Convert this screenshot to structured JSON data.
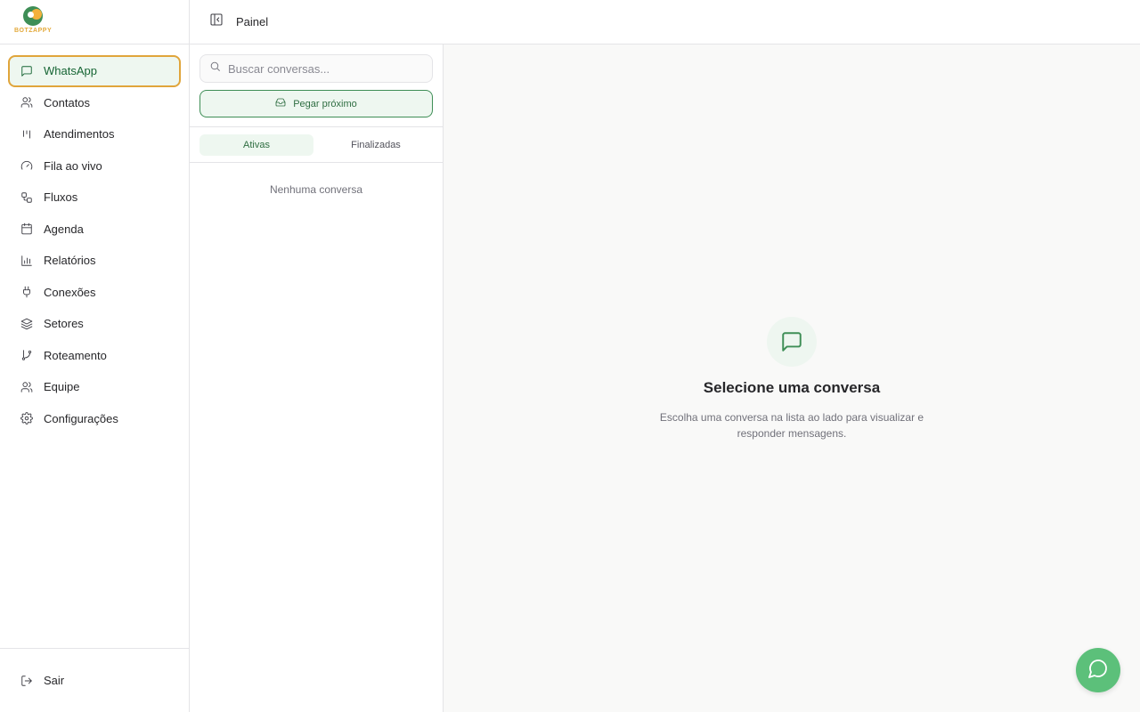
{
  "brand": {
    "wordmark": "BOTZAPPY"
  },
  "topbar": {
    "title": "Painel"
  },
  "sidebar": {
    "items": [
      {
        "label": "WhatsApp",
        "icon": "message-square-icon",
        "active": true
      },
      {
        "label": "Contatos",
        "icon": "users-icon"
      },
      {
        "label": "Atendimentos",
        "icon": "kanban-icon"
      },
      {
        "label": "Fila ao vivo",
        "icon": "gauge-icon"
      },
      {
        "label": "Fluxos",
        "icon": "workflow-icon"
      },
      {
        "label": "Agenda",
        "icon": "calendar-icon"
      },
      {
        "label": "Relatórios",
        "icon": "bar-chart-icon"
      },
      {
        "label": "Conexões",
        "icon": "plug-icon"
      },
      {
        "label": "Setores",
        "icon": "layers-icon"
      },
      {
        "label": "Roteamento",
        "icon": "git-branch-icon"
      },
      {
        "label": "Equipe",
        "icon": "users-icon"
      },
      {
        "label": "Configurações",
        "icon": "gear-icon"
      }
    ],
    "logout": {
      "label": "Sair",
      "icon": "logout-icon"
    }
  },
  "list_panel": {
    "search_placeholder": "Buscar conversas...",
    "next_button": "Pegar próximo",
    "tabs": [
      {
        "label": "Ativas",
        "active": true
      },
      {
        "label": "Finalizadas",
        "active": false
      }
    ],
    "empty_text": "Nenhuma conversa"
  },
  "main": {
    "empty_title": "Selecione uma conversa",
    "empty_description": "Escolha uma conversa na lista ao lado para visualizar e responder mensagens."
  },
  "colors": {
    "accent": "#3e8e56",
    "active_border": "#e0a53b",
    "fab": "#5cc07a"
  }
}
